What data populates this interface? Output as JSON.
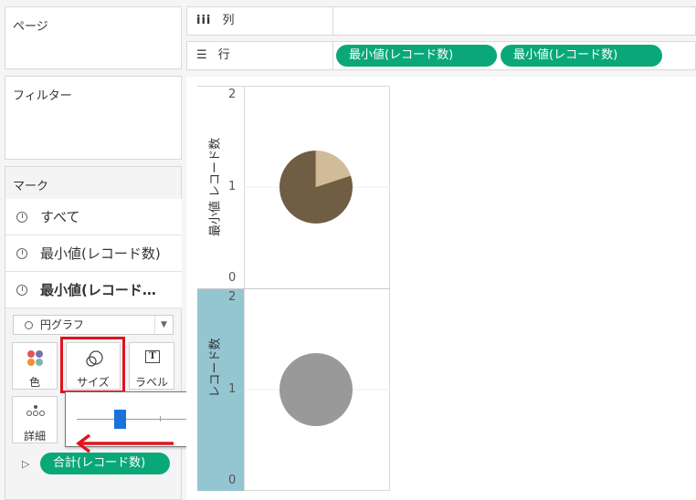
{
  "pages": {
    "title": "ページ"
  },
  "filters": {
    "title": "フィルター"
  },
  "marks": {
    "title": "マーク",
    "items": [
      {
        "label": "すべて"
      },
      {
        "label": "最小値(レコード数)"
      },
      {
        "label": "最小値(レコード…"
      }
    ],
    "mark_type": "円グラフ",
    "cards": {
      "color": "色",
      "size": "サイズ",
      "label": "ラベル",
      "detail": "詳細"
    },
    "field_pill": "合計(レコード数)"
  },
  "shelves": {
    "columns_label": "列",
    "rows_label": "行",
    "rows_pills": [
      "最小値(レコード数)",
      "最小値(レコード数)"
    ]
  },
  "colors": {
    "pill": "#0aa878",
    "highlight_red": "#e0141e",
    "axis_band": "#94c6d1",
    "pie_light": "#d2bb98",
    "pie_dark": "#6f5e43",
    "circle_gray": "#999999"
  },
  "chart_data": [
    {
      "type": "pie",
      "ylabel": "最小値 レコード数",
      "ylim": [
        0,
        2
      ],
      "y_ticks": [
        "2",
        "1",
        "0"
      ],
      "y": 1,
      "slices": [
        {
          "color": "#d2bb98",
          "value": 0.2
        },
        {
          "color": "#6f5e43",
          "value": 0.8
        }
      ]
    },
    {
      "type": "scatter",
      "ylabel": "レコード数",
      "ylim": [
        0,
        2
      ],
      "y_ticks": [
        "2",
        "1",
        "0"
      ],
      "y": 1
    }
  ]
}
